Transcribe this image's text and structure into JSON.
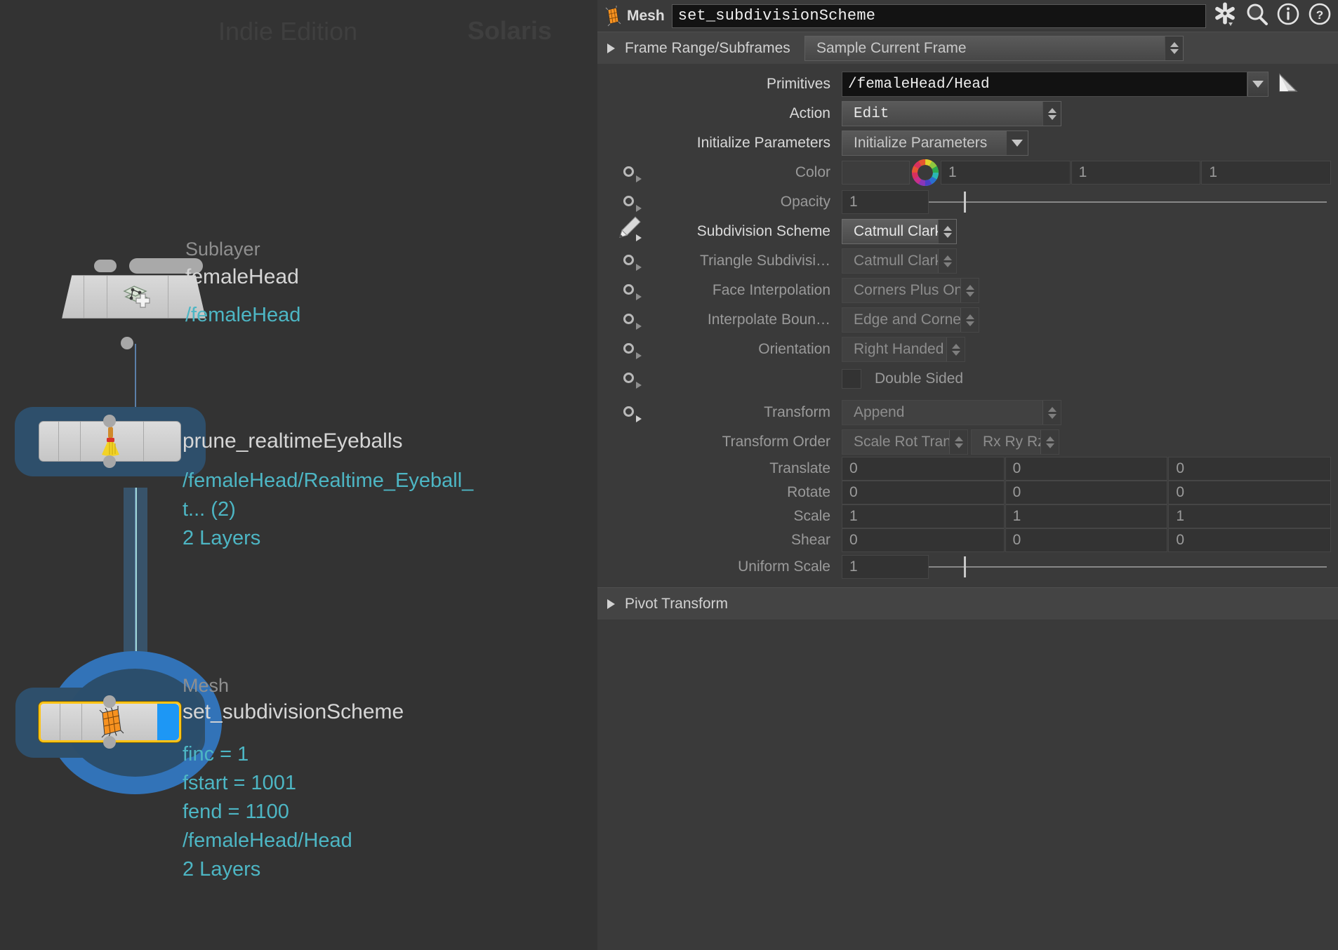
{
  "network": {
    "watermark_edition": "Indie Edition",
    "watermark_product": "Solaris",
    "nodes": [
      {
        "type": "Sublayer",
        "name": "femaleHead",
        "icon": "sublayer-icon",
        "meta": [
          "/femaleHead"
        ]
      },
      {
        "type": "",
        "name": "prune_realtimeEyeballs",
        "icon": "broom-icon",
        "meta": [
          "/femaleHead/Realtime_Eyeball_",
          "t... (2)",
          "2 Layers"
        ]
      },
      {
        "type": "Mesh",
        "name": "set_subdivisionScheme",
        "icon": "mesh-grid-icon",
        "meta": [
          "finc = 1",
          "fstart = 1001",
          "fend = 1100",
          "/femaleHead/Head",
          "2 Layers"
        ]
      }
    ],
    "colors": {
      "node_meta_text": "#4db6c4",
      "selection_outline": "#ffc315",
      "display_flag": "#1d97f5",
      "wire": "#5b7fa8"
    }
  },
  "params": {
    "header": {
      "type_icon": "mesh-grid-icon",
      "type_label": "Mesh",
      "node_name": "set_subdivisionScheme",
      "icons": [
        "gear-icon",
        "search-icon",
        "info-icon",
        "help-icon"
      ]
    },
    "sections": [
      {
        "label": "Frame Range/Subframes",
        "value": "Sample Current Frame"
      },
      {
        "label": "Pivot Transform"
      }
    ],
    "rows": [
      {
        "label": "Primitives",
        "value": "/femaleHead/Head",
        "widget": "textfield-dropdown"
      },
      {
        "label": "Action",
        "value": "Edit",
        "widget": "menu"
      },
      {
        "label": "Initialize Parameters",
        "value": "Initialize Parameters",
        "widget": "menu-caret"
      },
      {
        "label": "Color",
        "value": [
          "1",
          "1",
          "1"
        ],
        "widget": "color"
      },
      {
        "label": "Opacity",
        "value": "1",
        "widget": "slider"
      },
      {
        "label": "Subdivision Scheme",
        "value": "Catmull Clark",
        "widget": "menu",
        "state": "active"
      },
      {
        "label": "Triangle Subdivisi…",
        "value": "Catmull Clark",
        "widget": "menu",
        "state": "dimmed"
      },
      {
        "label": "Face Interpolation",
        "value": "Corners Plus One",
        "widget": "menu",
        "state": "dimmed"
      },
      {
        "label": "Interpolate Boun…",
        "value": "Edge and Corner",
        "widget": "menu",
        "state": "dimmed"
      },
      {
        "label": "Orientation",
        "value": "Right Handed",
        "widget": "menu",
        "state": "dimmed"
      },
      {
        "label": "Double Sided",
        "value": false,
        "widget": "checkbox"
      },
      {
        "label": "Transform",
        "value": "Append",
        "widget": "menu",
        "state": "dimmed"
      },
      {
        "label": "Transform Order",
        "value": [
          "Scale Rot Trans",
          "Rx Ry Rz"
        ],
        "widget": "menu-pair"
      },
      {
        "label": "Translate",
        "value": [
          "0",
          "0",
          "0"
        ],
        "widget": "vec3"
      },
      {
        "label": "Rotate",
        "value": [
          "0",
          "0",
          "0"
        ],
        "widget": "vec3"
      },
      {
        "label": "Scale",
        "value": [
          "1",
          "1",
          "1"
        ],
        "widget": "vec3"
      },
      {
        "label": "Shear",
        "value": [
          "0",
          "0",
          "0"
        ],
        "widget": "vec3"
      },
      {
        "label": "Uniform Scale",
        "value": "1",
        "widget": "slider"
      }
    ]
  }
}
